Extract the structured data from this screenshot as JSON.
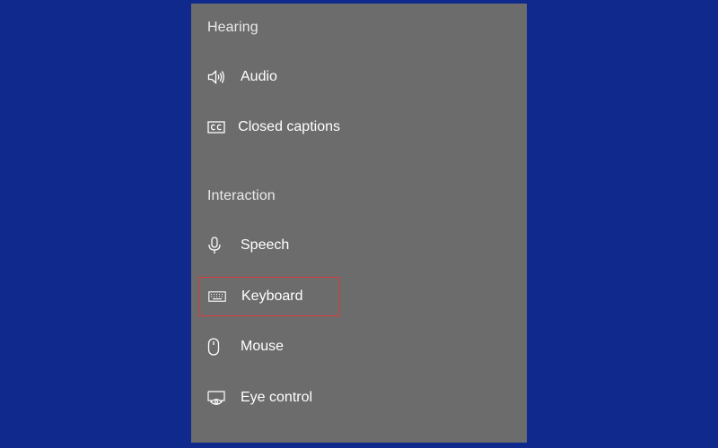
{
  "colors": {
    "background": "#0f2a8c",
    "panel": "#6c6c6c",
    "text": "#ffffff",
    "highlight_border": "#d93a3a"
  },
  "sections": [
    {
      "heading": "Hearing",
      "items": [
        {
          "label": "Audio",
          "icon": "speaker-icon"
        },
        {
          "label": "Closed captions",
          "icon": "closed-captions-icon"
        }
      ]
    },
    {
      "heading": "Interaction",
      "items": [
        {
          "label": "Speech",
          "icon": "microphone-icon"
        },
        {
          "label": "Keyboard",
          "icon": "keyboard-icon",
          "highlighted": true
        },
        {
          "label": "Mouse",
          "icon": "mouse-icon"
        },
        {
          "label": "Eye control",
          "icon": "eye-control-icon"
        }
      ]
    }
  ]
}
